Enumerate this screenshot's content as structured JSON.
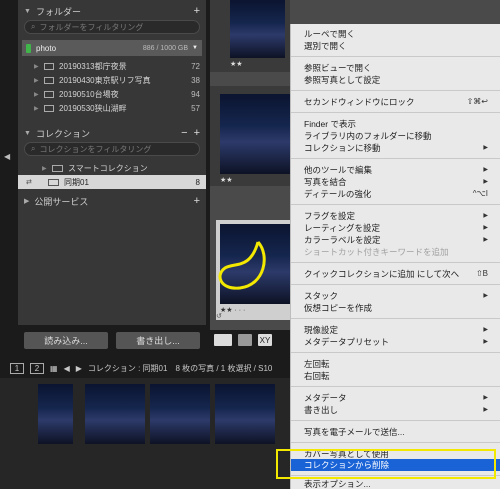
{
  "left_panel": {
    "folders_header": "フォルダー",
    "folder_search_placeholder": "フォルダーをフィルタリング",
    "drive": {
      "name": "photo",
      "capacity": "886 / 1000 GB"
    },
    "folders": [
      {
        "name": "20190313都庁夜景",
        "count": "72"
      },
      {
        "name": "20190430東京駅リフ写真",
        "count": "38"
      },
      {
        "name": "20190510台場夜",
        "count": "94"
      },
      {
        "name": "20190530狭山湖畔",
        "count": "57"
      }
    ],
    "collections_header": "コレクション",
    "collection_search_placeholder": "コレクションをフィルタリング",
    "smart_collection": "スマートコレクション",
    "selected_collection": {
      "name": "同期01",
      "count": "8"
    },
    "publish_header": "公開サービス",
    "import_button": "読み込み...",
    "export_button": "書き出し..."
  },
  "grid": {
    "stars_a": "★★",
    "stars_b": "★★",
    "stars_c": "★★ · · ·",
    "toolbar_x": "X",
    "toolbar_y": "Y"
  },
  "filmstrip": {
    "page1": "1",
    "page2": "2",
    "info": "コレクション : 同期01　8 枚の写真 / 1 枚選択 / S10"
  },
  "context_menu": {
    "items": [
      {
        "label": "ルーペで開く"
      },
      {
        "label": "選別で開く"
      },
      {
        "label": "参照ビューで開く"
      },
      {
        "label": "参照写真として設定"
      },
      {
        "label": "セカンドウィンドウにロック",
        "shortcut": "⇧⌘↩"
      },
      {
        "label": "Finder で表示"
      },
      {
        "label": "ライブラリ内のフォルダーに移動"
      },
      {
        "label": "コレクションに移動",
        "submenu": "▶"
      },
      {
        "label": "他のツールで編集",
        "submenu": "▶"
      },
      {
        "label": "写真を結合",
        "submenu": "▶"
      },
      {
        "label": "ディテールの強化",
        "shortcut": "^⌥I"
      },
      {
        "label": "フラグを設定",
        "submenu": "▶"
      },
      {
        "label": "レーティングを設定",
        "submenu": "▶"
      },
      {
        "label": "カラーラベルを設定",
        "submenu": "▶"
      },
      {
        "label": "ショートカット付きキーワードを追加",
        "disabled": true
      },
      {
        "label": "クイックコレクションに追加 にして次へ",
        "shortcut": "⇧B"
      },
      {
        "label": "スタック",
        "submenu": "▶"
      },
      {
        "label": "仮想コピーを作成"
      },
      {
        "label": "現像設定",
        "submenu": "▶"
      },
      {
        "label": "メタデータプリセット",
        "submenu": "▶"
      },
      {
        "label": "左回転"
      },
      {
        "label": "右回転"
      },
      {
        "label": "メタデータ",
        "submenu": "▶"
      },
      {
        "label": "書き出し",
        "submenu": "▶"
      },
      {
        "label": "写真を電子メールで送信..."
      },
      {
        "label": "カバー写真として使用"
      },
      {
        "label": "コレクションから削除",
        "highlighted": true
      },
      {
        "label": "表示オプション..."
      }
    ]
  },
  "colors": {
    "menu_highlight": "#1a63d7",
    "annotation_yellow": "#f2e800",
    "drive_led": "#3fb54a"
  }
}
